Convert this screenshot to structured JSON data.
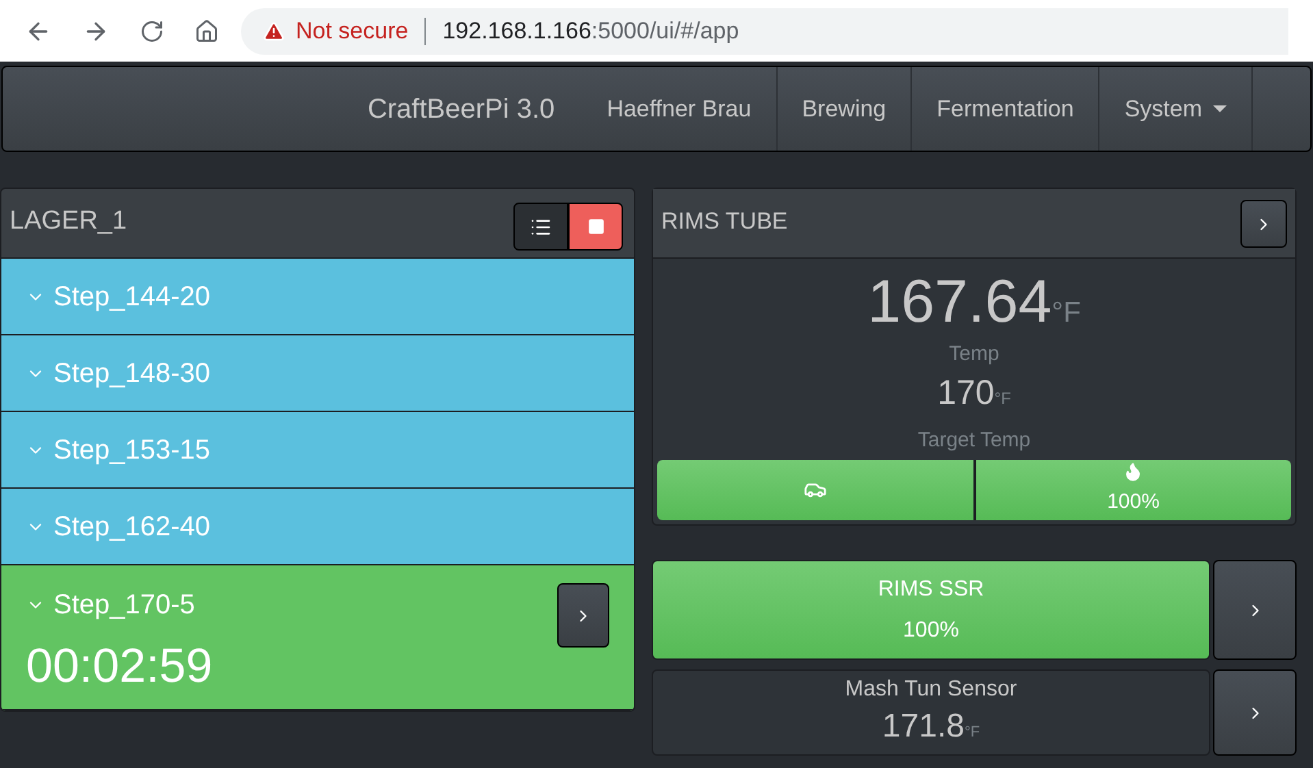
{
  "browser": {
    "security": "Not secure",
    "host": "192.168.1.166",
    "path": ":5000/ui/#/app"
  },
  "navbar": {
    "brand": "CraftBeerPi 3.0",
    "items": [
      {
        "label": "Haeffner Brau",
        "dropdown": false
      },
      {
        "label": "Brewing",
        "dropdown": false
      },
      {
        "label": "Fermentation",
        "dropdown": false
      },
      {
        "label": "System",
        "dropdown": true
      }
    ]
  },
  "fermenter": {
    "title": "LAGER_1",
    "running": true,
    "steps": [
      {
        "name": "Step_144-20",
        "active": false
      },
      {
        "name": "Step_148-30",
        "active": false
      },
      {
        "name": "Step_153-15",
        "active": false
      },
      {
        "name": "Step_162-40",
        "active": false
      },
      {
        "name": "Step_170-5",
        "active": true,
        "timer": "00:02:59"
      }
    ]
  },
  "kettle": {
    "title": "RIMS TUBE",
    "temp": "167.64",
    "temp_unit": "°F",
    "temp_label": "Temp",
    "target": "170",
    "target_unit": "°F",
    "target_label": "Target Temp",
    "actors": [
      {
        "kind": "pump",
        "on": true
      },
      {
        "kind": "heater",
        "on": true,
        "power": "100%"
      }
    ]
  },
  "widgets": [
    {
      "kind": "actor",
      "name": "RIMS SSR",
      "on": true,
      "power": "100%"
    },
    {
      "kind": "sensor",
      "name": "Mash Tun Sensor",
      "value": "171.8",
      "unit": "°F"
    }
  ]
}
